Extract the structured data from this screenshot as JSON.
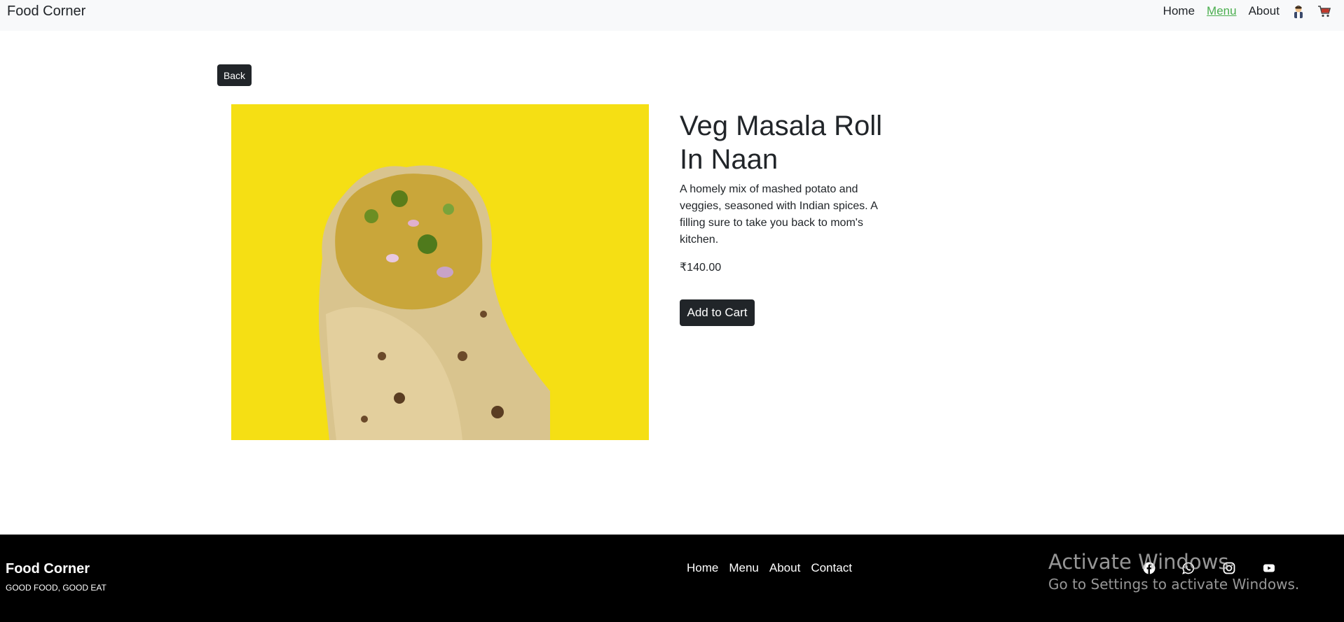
{
  "navbar": {
    "brand": "Food Corner",
    "links": [
      {
        "label": "Home",
        "active": false
      },
      {
        "label": "Menu",
        "active": true
      },
      {
        "label": "About",
        "active": false
      }
    ],
    "icons": [
      "user-icon",
      "cart-icon"
    ]
  },
  "back_button": "Back",
  "product": {
    "title": "Veg Masala Roll In Naan",
    "description": "A homely mix of mashed potato and veggies, seasoned with Indian spices. A filling sure to take you back to mom's kitchen.",
    "price": "₹140.00",
    "add_to_cart": "Add to Cart",
    "image_background": "#f5df14"
  },
  "footer": {
    "brand": "Food Corner",
    "tagline": "GOOD FOOD, GOOD EAT",
    "links": [
      "Home",
      "Menu",
      "About",
      "Contact"
    ],
    "social_icons": [
      "facebook-icon",
      "whatsapp-icon",
      "instagram-icon",
      "youtube-icon"
    ]
  },
  "watermark": {
    "title": "Activate Windows",
    "subtitle": "Go to Settings to activate Windows."
  },
  "colors": {
    "accent_active": "#4caf50",
    "dark_button": "#212529",
    "footer_bg": "#000000",
    "navbar_bg": "#f8f9fa"
  }
}
